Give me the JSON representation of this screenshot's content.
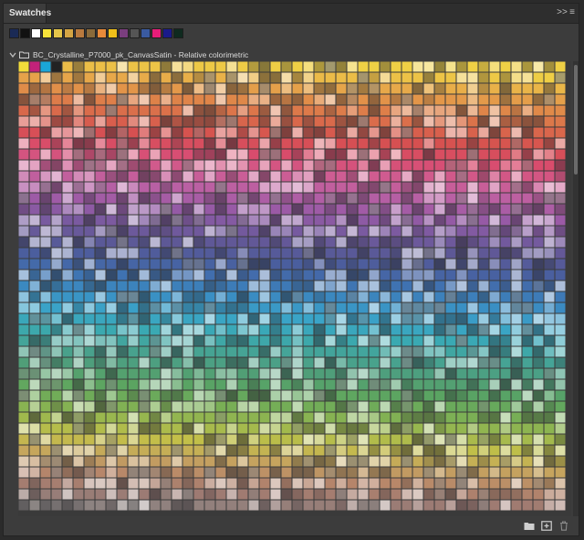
{
  "panel": {
    "tab_label": "Swatches",
    "expand_glyph": ">>",
    "menu_glyph": "≡"
  },
  "recent_colors": [
    "#1a2a55",
    "#111111",
    "#ffffff",
    "#f7e33a",
    "#e6c64a",
    "#d4a544",
    "#b97a3e",
    "#8a6a3a",
    "#e88a3a",
    "#f0c01a",
    "#7a3e7e",
    "#555555",
    "#3a5aa0",
    "#e81d79",
    "#1a1a8a",
    "#0f2a1f"
  ],
  "group": {
    "name": "BC_Crystalline_P7000_pk_CanvasSatin - Relative colorimetric",
    "expanded": true,
    "first_row": [
      "#f2dc3a",
      "#c2227a",
      "#1aa6d8",
      "#222222"
    ],
    "band_colors": [
      "#efd045",
      "#e7a94a",
      "#df8649",
      "#d9694b",
      "#d65050",
      "#d94c6e",
      "#cf5d93",
      "#b960a4",
      "#9a5aa6",
      "#7a5aa0",
      "#5e5896",
      "#4a5e9e",
      "#3f73b2",
      "#3a8fc4",
      "#3aa4c8",
      "#3aa9b2",
      "#46a394",
      "#4f9e7a",
      "#5aa462",
      "#76ae56",
      "#9cb84e",
      "#c3bf49",
      "#c6a45e",
      "#b7866a",
      "#9e7a72",
      "#8a8584"
    ]
  },
  "footer_icons": [
    "folder-icon",
    "new-swatch-icon",
    "trash-icon"
  ]
}
